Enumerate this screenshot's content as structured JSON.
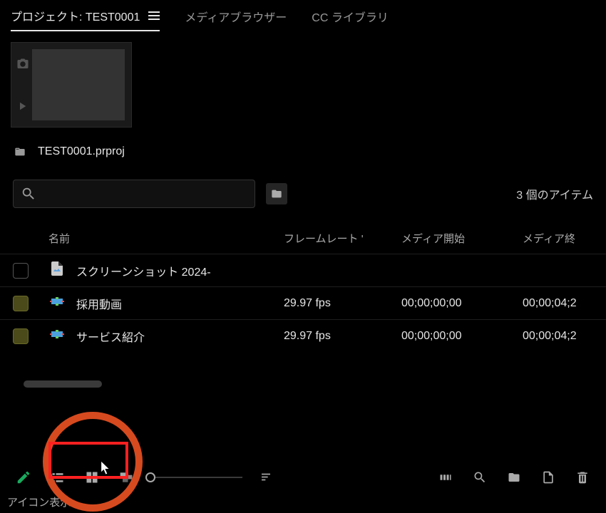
{
  "tabs": {
    "project": "プロジェクト: TEST0001",
    "mediaBrowser": "メディアブラウザー",
    "ccLibraries": "CC ライブラリ"
  },
  "projectFile": "TEST0001.prproj",
  "itemCount": "3 個のアイテム",
  "columns": {
    "name": "名前",
    "frameRate": "フレームレート",
    "mediaStart": "メディア開始",
    "mediaEnd": "メディア終"
  },
  "rows": [
    {
      "type": "image",
      "name": "スクリーンショット 2024-",
      "fps": "",
      "start": "",
      "end": "",
      "color": "gray"
    },
    {
      "type": "sequence",
      "name": "採用動画",
      "fps": "29.97 fps",
      "start": "00;00;00;00",
      "end": "00;00;04;2",
      "color": "olive"
    },
    {
      "type": "sequence",
      "name": "サービス紹介",
      "fps": "29.97 fps",
      "start": "00;00;00;00",
      "end": "00;00;04;2",
      "color": "olive"
    }
  ],
  "statusBar": "アイコン表示",
  "searchPlaceholder": ""
}
